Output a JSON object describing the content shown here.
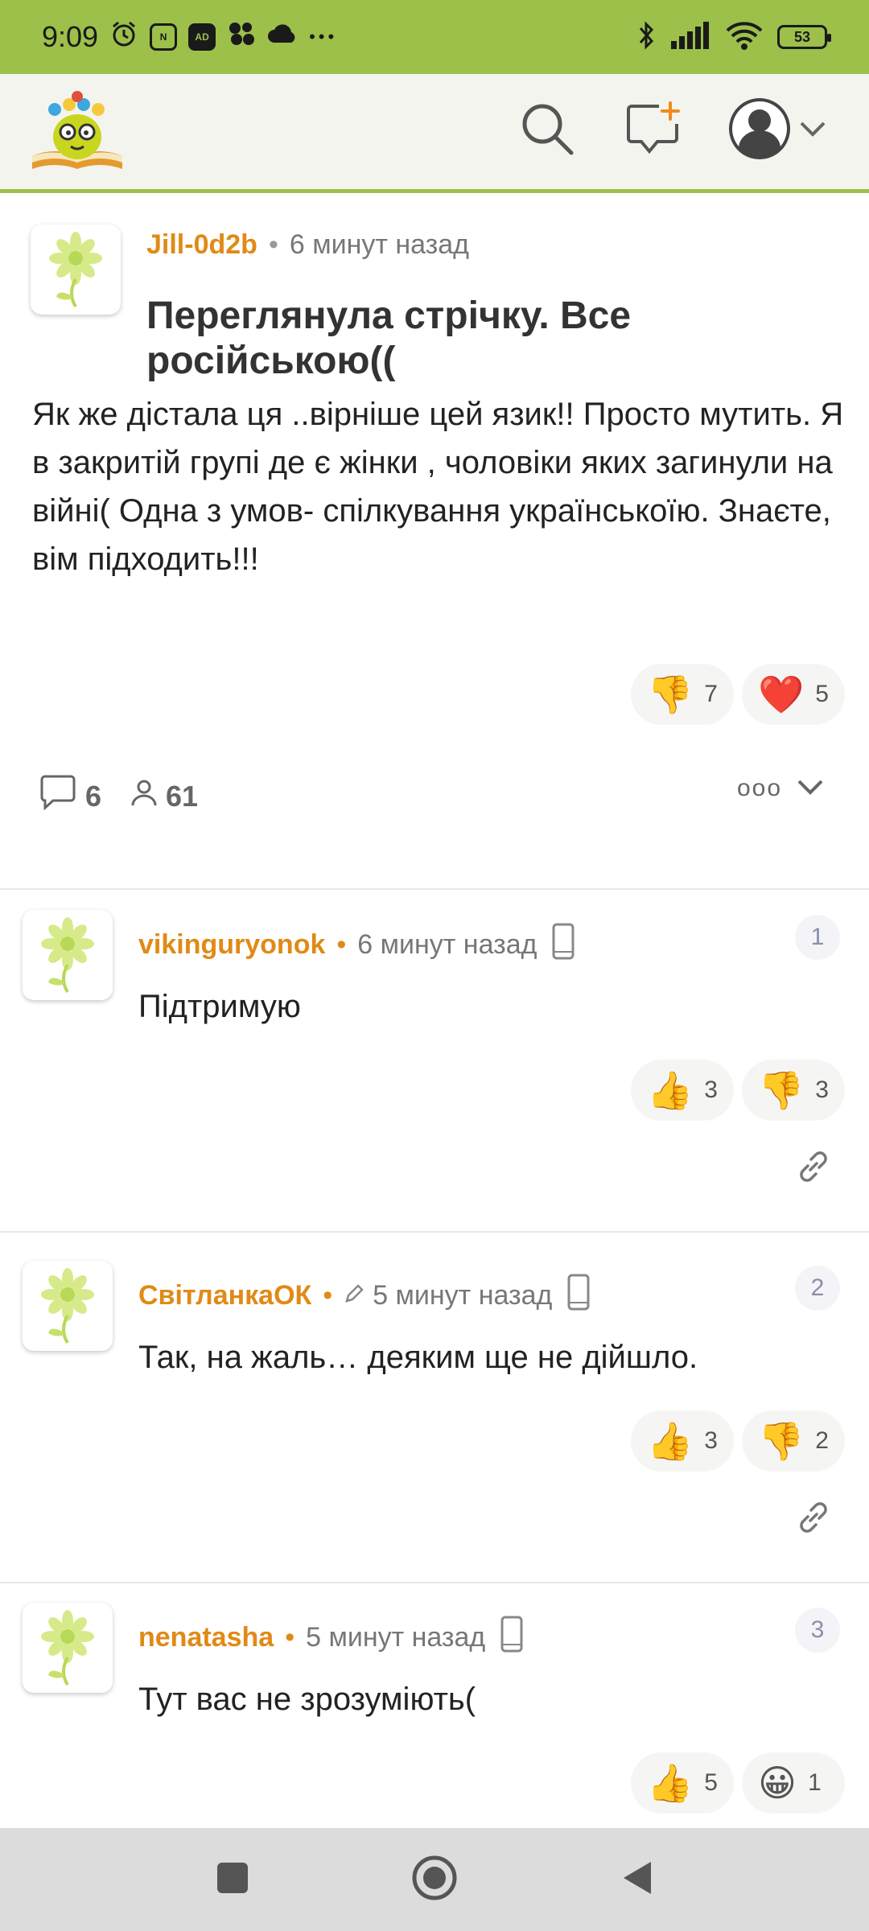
{
  "status_bar": {
    "time": "9:09",
    "ad_badge": "AD",
    "battery": "53",
    "more": "•••"
  },
  "header": {
    "search_icon": "search-icon",
    "compose_icon": "add-comment-icon",
    "avatar_icon": "user-avatar-icon"
  },
  "post": {
    "author": "Jill-0d2b",
    "time_ago": "6 минут назад",
    "title": "Переглянула стрічку. Все російською((",
    "body": "Як же дістала ця ..вірніше цей язик!! Просто мутить. Я в закритій групі де є жінки , чоловіки яких загинули на війні( Одна з умов- спілкування українськоїю. Знаєте, вім підходить!!!",
    "reactions": [
      {
        "emoji": "👎",
        "count": "7"
      },
      {
        "emoji": "❤️",
        "count": "5"
      }
    ],
    "comments_count": "6",
    "viewers_count": "61",
    "more_label": "ooo"
  },
  "comments": [
    {
      "author": "vikinguryonok",
      "time_ago": "6 минут назад",
      "number": "1",
      "text": "Підтримую",
      "reactions": [
        {
          "emoji": "👍",
          "count": "3"
        },
        {
          "emoji": "👎",
          "count": "3"
        }
      ]
    },
    {
      "author": "СвітланкаОК",
      "time_ago": "5 минут назад",
      "number": "2",
      "text": "Так, на жаль… деяким ще не дійшло.",
      "reactions": [
        {
          "emoji": "👍",
          "count": "3"
        },
        {
          "emoji": "👎",
          "count": "2"
        }
      ]
    },
    {
      "author": "nenatasha",
      "time_ago": "5 минут назад",
      "number": "3",
      "text": "Тут вас не зрозуміють(",
      "reactions": [
        {
          "emoji": "👍",
          "count": "5"
        },
        {
          "emoji": "😀",
          "count": "1"
        }
      ]
    }
  ]
}
